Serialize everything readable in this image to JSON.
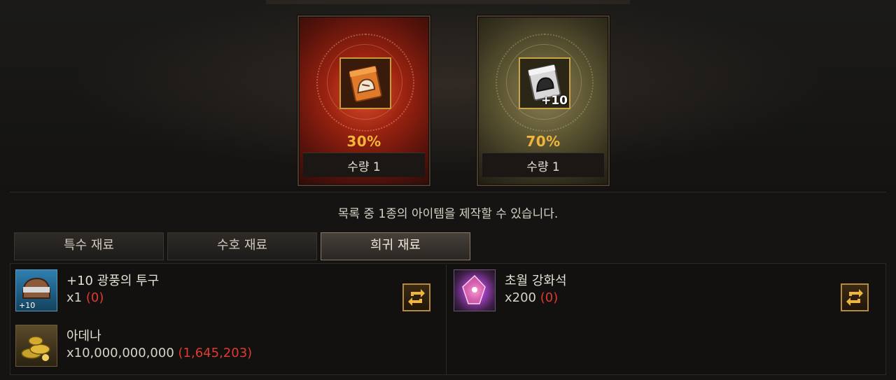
{
  "cards": [
    {
      "percent": "30%",
      "quantity": "수량 1",
      "variant": "red",
      "badge": ""
    },
    {
      "percent": "70%",
      "quantity": "수량 1",
      "variant": "gold",
      "badge": "+10"
    }
  ],
  "notice": "목록 중 1종의 아이템을 제작할 수 있습니다.",
  "tabs": [
    {
      "label": "특수 재료",
      "active": false
    },
    {
      "label": "수호 재료",
      "active": false
    },
    {
      "label": "희귀 재료",
      "active": true
    }
  ],
  "materials": [
    {
      "name": "+10 광풍의 투구",
      "required": "x1",
      "owned": "(0)",
      "icon": "helmet-icon",
      "badge": "+10"
    },
    {
      "name": "아데나",
      "required": "x10,000,000,000",
      "owned": "(1,645,203)",
      "icon": "adena-coins-icon"
    },
    {
      "name": "초월 강화석",
      "required": "x200",
      "owned": "(0)",
      "icon": "enhance-stone-icon"
    }
  ],
  "colors": {
    "accent": "#f0b53a",
    "shortage": "#e03a2e",
    "tab_active_border": "#8a7a64"
  }
}
